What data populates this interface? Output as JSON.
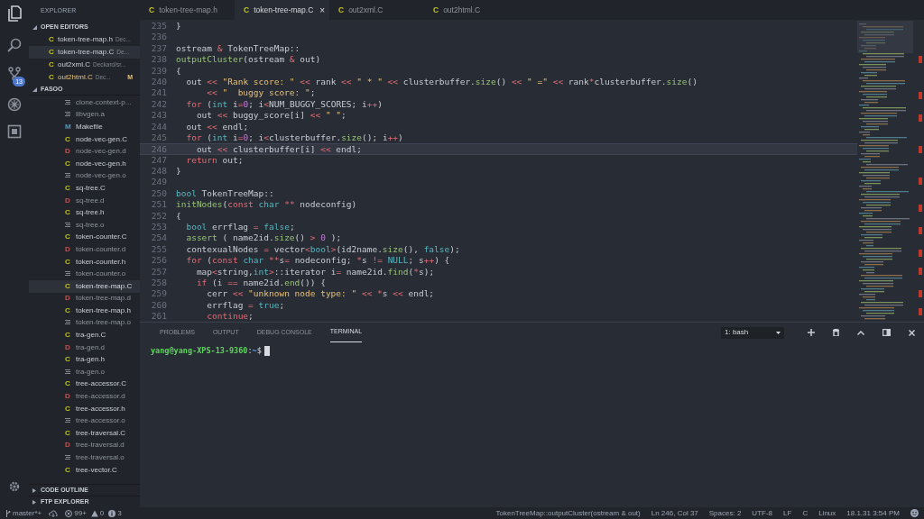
{
  "activity_bar": {
    "scm_badge": "13"
  },
  "sidebar": {
    "title": "EXPLORER",
    "open_editors": {
      "title": "OPEN EDITORS",
      "expanded": true,
      "items": [
        {
          "icon": "C",
          "name": "token-tree-map.h",
          "path": "Dec...",
          "modified": false,
          "selected": false
        },
        {
          "icon": "C",
          "name": "token-tree-map.C",
          "path": "De...",
          "modified": false,
          "selected": true
        },
        {
          "icon": "C",
          "name": "out2xml.C",
          "path": "Deckard/sr...",
          "modified": false,
          "selected": false
        },
        {
          "icon": "C",
          "name": "out2html.C",
          "path": "Dec...",
          "modified": true,
          "badge": "M",
          "selected": false
        }
      ]
    },
    "folder": {
      "title": "FASOO",
      "expanded": true,
      "items": [
        {
          "kind": "obj",
          "name": "clone-context-p...",
          "selected": false
        },
        {
          "kind": "obj",
          "name": "libvgen.a",
          "selected": false
        },
        {
          "kind": "make",
          "icon": "M",
          "name": "Makefile",
          "selected": false
        },
        {
          "kind": "c",
          "icon": "C",
          "name": "node-vec-gen.C",
          "selected": false
        },
        {
          "kind": "d",
          "icon": "D",
          "name": "node-vec-gen.d",
          "selected": false
        },
        {
          "kind": "c",
          "icon": "C",
          "name": "node-vec-gen.h",
          "selected": false
        },
        {
          "kind": "obj",
          "name": "node-vec-gen.o",
          "selected": false
        },
        {
          "kind": "c",
          "icon": "C",
          "name": "sq-tree.C",
          "selected": false
        },
        {
          "kind": "d",
          "icon": "D",
          "name": "sq-tree.d",
          "selected": false
        },
        {
          "kind": "c",
          "icon": "C",
          "name": "sq-tree.h",
          "selected": false
        },
        {
          "kind": "obj",
          "name": "sq-tree.o",
          "selected": false
        },
        {
          "kind": "c",
          "icon": "C",
          "name": "token-counter.C",
          "selected": false
        },
        {
          "kind": "d",
          "icon": "D",
          "name": "token-counter.d",
          "selected": false
        },
        {
          "kind": "c",
          "icon": "C",
          "name": "token-counter.h",
          "selected": false
        },
        {
          "kind": "obj",
          "name": "token-counter.o",
          "selected": false
        },
        {
          "kind": "c",
          "icon": "C",
          "name": "token-tree-map.C",
          "selected": true
        },
        {
          "kind": "d",
          "icon": "D",
          "name": "token-tree-map.d",
          "selected": false
        },
        {
          "kind": "c",
          "icon": "C",
          "name": "token-tree-map.h",
          "selected": false
        },
        {
          "kind": "obj",
          "name": "token-tree-map.o",
          "selected": false
        },
        {
          "kind": "c",
          "icon": "C",
          "name": "tra-gen.C",
          "selected": false
        },
        {
          "kind": "d",
          "icon": "D",
          "name": "tra-gen.d",
          "selected": false
        },
        {
          "kind": "c",
          "icon": "C",
          "name": "tra-gen.h",
          "selected": false
        },
        {
          "kind": "obj",
          "name": "tra-gen.o",
          "selected": false
        },
        {
          "kind": "c",
          "icon": "C",
          "name": "tree-accessor.C",
          "selected": false
        },
        {
          "kind": "d",
          "icon": "D",
          "name": "tree-accessor.d",
          "selected": false
        },
        {
          "kind": "c",
          "icon": "C",
          "name": "tree-accessor.h",
          "selected": false
        },
        {
          "kind": "obj",
          "name": "tree-accessor.o",
          "selected": false
        },
        {
          "kind": "c",
          "icon": "C",
          "name": "tree-traversal.C",
          "selected": false
        },
        {
          "kind": "d",
          "icon": "D",
          "name": "tree-traversal.d",
          "selected": false
        },
        {
          "kind": "obj",
          "name": "tree-traversal.o",
          "selected": false
        },
        {
          "kind": "c",
          "icon": "C",
          "name": "tree-vector.C",
          "selected": false
        }
      ]
    },
    "sections": [
      {
        "title": "CODE OUTLINE",
        "expanded": false
      },
      {
        "title": "FTP EXPLORER",
        "expanded": false
      }
    ]
  },
  "tabs": [
    {
      "icon": "C",
      "label": "token-tree-map.h",
      "selected": false
    },
    {
      "icon": "C",
      "label": "token-tree-map.C",
      "selected": true,
      "close": "×"
    },
    {
      "icon": "C",
      "label": "out2xml.C",
      "selected": false
    },
    {
      "icon": "C",
      "label": "out2html.C",
      "selected": false
    }
  ],
  "editor": {
    "lines": [
      {
        "number": "235",
        "current": false,
        "tokens": [
          {
            "kind": "p",
            "text": "}"
          }
        ]
      },
      {
        "number": "236",
        "current": false
      },
      {
        "number": "237",
        "current": false,
        "tokens": [
          {
            "kind": "p",
            "text": "ostream "
          },
          {
            "kind": "op",
            "text": "&"
          },
          {
            "kind": "p",
            "text": " TokenTreeMap::"
          }
        ]
      },
      {
        "number": "238",
        "current": false,
        "tokens": [
          {
            "kind": "fn",
            "text": "outputCluster"
          },
          {
            "kind": "p",
            "text": "(ostream "
          },
          {
            "kind": "op",
            "text": "&"
          },
          {
            "kind": "p",
            "text": " out)"
          }
        ]
      },
      {
        "number": "239",
        "current": false,
        "tokens": [
          {
            "kind": "p",
            "text": "{"
          }
        ]
      },
      {
        "number": "240",
        "current": false,
        "tokens": [
          {
            "kind": "p",
            "text": "  out "
          },
          {
            "kind": "op",
            "text": "<<"
          },
          {
            "kind": "str",
            "text": " \"Rank score: \""
          },
          {
            "kind": "op",
            "text": " <<"
          },
          {
            "kind": "p",
            "text": " rank "
          },
          {
            "kind": "op",
            "text": "<<"
          },
          {
            "kind": "str",
            "text": " \" * \""
          },
          {
            "kind": "op",
            "text": " <<"
          },
          {
            "kind": "p",
            "text": " clusterbuffer."
          },
          {
            "kind": "fn",
            "text": "size"
          },
          {
            "kind": "p",
            "text": "() "
          },
          {
            "kind": "op",
            "text": "<<"
          },
          {
            "kind": "str",
            "text": " \" =\""
          },
          {
            "kind": "op",
            "text": " <<"
          },
          {
            "kind": "p",
            "text": " rank"
          },
          {
            "kind": "op",
            "text": "*"
          },
          {
            "kind": "p",
            "text": "clusterbuffer."
          },
          {
            "kind": "fn",
            "text": "size"
          },
          {
            "kind": "p",
            "text": "()"
          }
        ]
      },
      {
        "number": "241",
        "current": false,
        "tokens": [
          {
            "kind": "op",
            "text": "      <<"
          },
          {
            "kind": "str",
            "text": " \"  buggy score: \""
          },
          {
            "kind": "p",
            "text": ";"
          }
        ]
      },
      {
        "number": "242",
        "current": false,
        "tokens": [
          {
            "kind": "kw",
            "text": "  for"
          },
          {
            "kind": "p",
            "text": " ("
          },
          {
            "kind": "ty",
            "text": "int"
          },
          {
            "kind": "p",
            "text": " i"
          },
          {
            "kind": "op",
            "text": "="
          },
          {
            "kind": "num",
            "text": "0"
          },
          {
            "kind": "p",
            "text": "; i"
          },
          {
            "kind": "op",
            "text": "<"
          },
          {
            "kind": "p",
            "text": "NUM_BUGGY_SCORES; i"
          },
          {
            "kind": "op",
            "text": "++"
          },
          {
            "kind": "p",
            "text": ")"
          }
        ]
      },
      {
        "number": "243",
        "current": false,
        "tokens": [
          {
            "kind": "p",
            "text": "    out "
          },
          {
            "kind": "op",
            "text": "<<"
          },
          {
            "kind": "p",
            "text": " buggy_score[i] "
          },
          {
            "kind": "op",
            "text": "<<"
          },
          {
            "kind": "str",
            "text": " \" \""
          },
          {
            "kind": "p",
            "text": ";"
          }
        ]
      },
      {
        "number": "244",
        "current": false,
        "tokens": [
          {
            "kind": "p",
            "text": "  out "
          },
          {
            "kind": "op",
            "text": "<<"
          },
          {
            "kind": "p",
            "text": " endl;"
          }
        ]
      },
      {
        "number": "245",
        "current": false,
        "tokens": [
          {
            "kind": "kw",
            "text": "  for"
          },
          {
            "kind": "p",
            "text": " ("
          },
          {
            "kind": "ty",
            "text": "int"
          },
          {
            "kind": "p",
            "text": " i"
          },
          {
            "kind": "op",
            "text": "="
          },
          {
            "kind": "num",
            "text": "0"
          },
          {
            "kind": "p",
            "text": "; i"
          },
          {
            "kind": "op",
            "text": "<"
          },
          {
            "kind": "p",
            "text": "clusterbuffer."
          },
          {
            "kind": "fn",
            "text": "size"
          },
          {
            "kind": "p",
            "text": "(); i"
          },
          {
            "kind": "op",
            "text": "++"
          },
          {
            "kind": "p",
            "text": ")"
          }
        ]
      },
      {
        "number": "246",
        "current": true,
        "tokens": [
          {
            "kind": "p",
            "text": "    out "
          },
          {
            "kind": "op",
            "text": "<<"
          },
          {
            "kind": "p",
            "text": " clusterbuffer[i] "
          },
          {
            "kind": "op",
            "text": "<<"
          },
          {
            "kind": "p",
            "text": " endl;"
          }
        ]
      },
      {
        "number": "247",
        "current": false,
        "tokens": [
          {
            "kind": "kw",
            "text": "  return"
          },
          {
            "kind": "p",
            "text": " out;"
          }
        ]
      },
      {
        "number": "248",
        "current": false,
        "tokens": [
          {
            "kind": "p",
            "text": "}"
          }
        ]
      },
      {
        "number": "249",
        "current": false
      },
      {
        "number": "250",
        "current": false,
        "tokens": [
          {
            "kind": "ty",
            "text": "bool"
          },
          {
            "kind": "p",
            "text": " TokenTreeMap::"
          }
        ]
      },
      {
        "number": "251",
        "current": false,
        "tokens": [
          {
            "kind": "fn",
            "text": "initNodes"
          },
          {
            "kind": "p",
            "text": "("
          },
          {
            "kind": "kw",
            "text": "const"
          },
          {
            "kind": "ty",
            "text": " char"
          },
          {
            "kind": "op",
            "text": " **"
          },
          {
            "kind": "p",
            "text": " nodeconfig)"
          }
        ]
      },
      {
        "number": "252",
        "current": false,
        "tokens": [
          {
            "kind": "p",
            "text": "{"
          }
        ]
      },
      {
        "number": "253",
        "current": false,
        "tokens": [
          {
            "kind": "ty",
            "text": "  bool"
          },
          {
            "kind": "p",
            "text": " errflag "
          },
          {
            "kind": "op",
            "text": "="
          },
          {
            "kind": "ty",
            "text": " false"
          },
          {
            "kind": "p",
            "text": ";"
          }
        ]
      },
      {
        "number": "254",
        "current": false,
        "tokens": [
          {
            "kind": "fn",
            "text": "  assert"
          },
          {
            "kind": "p",
            "text": " ( name2id."
          },
          {
            "kind": "fn",
            "text": "size"
          },
          {
            "kind": "p",
            "text": "() "
          },
          {
            "kind": "op",
            "text": ">"
          },
          {
            "kind": "num",
            "text": " 0"
          },
          {
            "kind": "p",
            "text": " );"
          }
        ]
      },
      {
        "number": "255",
        "current": false,
        "tokens": [
          {
            "kind": "p",
            "text": "  contexualNodes "
          },
          {
            "kind": "op",
            "text": "="
          },
          {
            "kind": "p",
            "text": " vector"
          },
          {
            "kind": "op",
            "text": "<"
          },
          {
            "kind": "ty",
            "text": "bool"
          },
          {
            "kind": "op",
            "text": ">"
          },
          {
            "kind": "p",
            "text": "(id2name."
          },
          {
            "kind": "fn",
            "text": "size"
          },
          {
            "kind": "p",
            "text": "(), "
          },
          {
            "kind": "ty",
            "text": "false"
          },
          {
            "kind": "p",
            "text": ");"
          }
        ]
      },
      {
        "number": "256",
        "current": false,
        "tokens": [
          {
            "kind": "kw",
            "text": "  for"
          },
          {
            "kind": "p",
            "text": " ("
          },
          {
            "kind": "kw",
            "text": "const"
          },
          {
            "kind": "ty",
            "text": " char"
          },
          {
            "kind": "op",
            "text": " **"
          },
          {
            "kind": "p",
            "text": "s"
          },
          {
            "kind": "op",
            "text": "="
          },
          {
            "kind": "p",
            "text": " nodeconfig; "
          },
          {
            "kind": "op",
            "text": "*"
          },
          {
            "kind": "p",
            "text": "s "
          },
          {
            "kind": "op",
            "text": "!="
          },
          {
            "kind": "ty",
            "text": " NULL"
          },
          {
            "kind": "p",
            "text": "; s"
          },
          {
            "kind": "op",
            "text": "++"
          },
          {
            "kind": "p",
            "text": ") {"
          }
        ]
      },
      {
        "number": "257",
        "current": false,
        "tokens": [
          {
            "kind": "p",
            "text": "    map"
          },
          {
            "kind": "op",
            "text": "<"
          },
          {
            "kind": "p",
            "text": "string,"
          },
          {
            "kind": "ty",
            "text": "int"
          },
          {
            "kind": "op",
            "text": ">"
          },
          {
            "kind": "p",
            "text": "::iterator i"
          },
          {
            "kind": "op",
            "text": "="
          },
          {
            "kind": "p",
            "text": " name2id."
          },
          {
            "kind": "fn",
            "text": "find"
          },
          {
            "kind": "p",
            "text": "("
          },
          {
            "kind": "op",
            "text": "*"
          },
          {
            "kind": "p",
            "text": "s);"
          }
        ]
      },
      {
        "number": "258",
        "current": false,
        "tokens": [
          {
            "kind": "kw",
            "text": "    if"
          },
          {
            "kind": "p",
            "text": " (i "
          },
          {
            "kind": "op",
            "text": "=="
          },
          {
            "kind": "p",
            "text": " name2id."
          },
          {
            "kind": "fn",
            "text": "end"
          },
          {
            "kind": "p",
            "text": "()) {"
          }
        ]
      },
      {
        "number": "259",
        "current": false,
        "tokens": [
          {
            "kind": "p",
            "text": "      cerr "
          },
          {
            "kind": "op",
            "text": "<<"
          },
          {
            "kind": "str",
            "text": " \"unknown node type: \""
          },
          {
            "kind": "op",
            "text": " <<"
          },
          {
            "kind": "op",
            "text": " *"
          },
          {
            "kind": "p",
            "text": "s "
          },
          {
            "kind": "op",
            "text": "<<"
          },
          {
            "kind": "p",
            "text": " endl;"
          }
        ]
      },
      {
        "number": "260",
        "current": false,
        "tokens": [
          {
            "kind": "p",
            "text": "      errflag "
          },
          {
            "kind": "op",
            "text": "="
          },
          {
            "kind": "ty",
            "text": " true"
          },
          {
            "kind": "p",
            "text": ";"
          }
        ]
      },
      {
        "number": "261",
        "current": false,
        "tokens": [
          {
            "kind": "kw",
            "text": "      continue"
          },
          {
            "kind": "p",
            "text": ";"
          }
        ]
      }
    ]
  },
  "panel": {
    "tabs": [
      {
        "label": "PROBLEMS",
        "selected": false
      },
      {
        "label": "OUTPUT",
        "selected": false
      },
      {
        "label": "DEBUG CONSOLE",
        "selected": false
      },
      {
        "label": "TERMINAL",
        "selected": true
      }
    ],
    "terminal_select": "1: bash",
    "prompt": {
      "user_host": "yang@yang-XPS-13-9360",
      "separator": ":",
      "path": "~",
      "symbol": "$"
    }
  },
  "status_bar": {
    "branch": "master*+",
    "errors": "99+",
    "warnings": "0",
    "infos": "3",
    "right": [
      "TokenTreeMap::outputCluster(ostream & out)",
      "Ln 246, Col 37",
      "Spaces: 2",
      "UTF-8",
      "LF",
      "C",
      "Linux",
      "18.1.31 3:54 PM"
    ]
  }
}
